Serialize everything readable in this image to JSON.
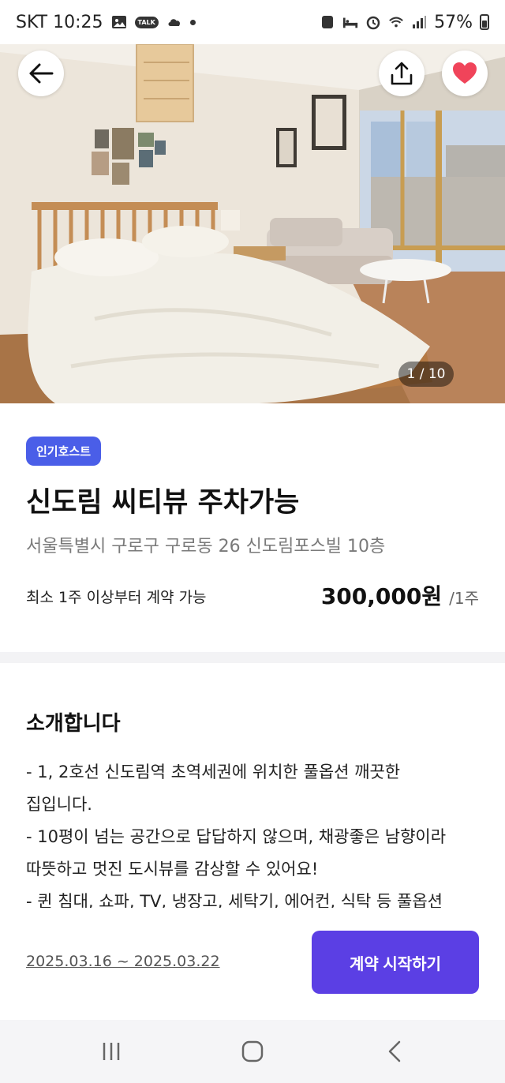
{
  "status_bar": {
    "carrier_time": "SKT 10:25",
    "talk_badge": "TALK",
    "battery": "57%"
  },
  "hero": {
    "photo_counter": "1 / 10"
  },
  "listing": {
    "badge": "인기호스트",
    "title": "신도림 씨티뷰 주차가능",
    "address": "서울특별시 구로구 구로동 26 신도림포스빌 10층",
    "min_term": "최소 1주 이상부터 계약 가능",
    "price": "300,000원",
    "price_unit": "/1주"
  },
  "intro": {
    "title": "소개합니다",
    "lines": [
      "- 1, 2호선 신도림역 초역세권에 위치한 풀옵션 깨끗한",
      "집입니다.",
      "- 10평이 넘는 공간으로 답답하지 않으며, 채광좋은 남향이라",
      "따뜻하고 멋진 도시뷰를 감상할 수 있어요!",
      "- 퀸 침대, 쇼파, TV, 냉장고, 세탁기, 에어컨, 식탁 등 풀옵션"
    ]
  },
  "bottom_bar": {
    "date_range": "2025.03.16 ~ 2025.03.22",
    "cta_label": "계약 시작하기"
  },
  "colors": {
    "badge": "#4a5ee8",
    "cta": "#5b3fe4",
    "heart": "#f0445a"
  }
}
